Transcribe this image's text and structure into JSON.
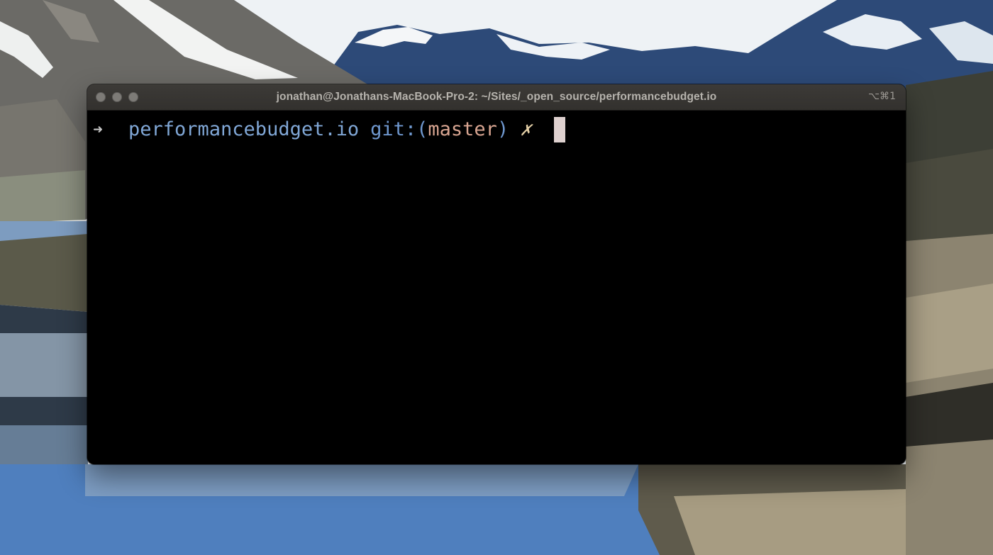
{
  "window": {
    "title": "jonathan@Jonathans-MacBook-Pro-2: ~/Sites/_open_source/performancebudget.io",
    "shortcut": "⌥⌘1"
  },
  "prompt": {
    "arrow": "➜",
    "directory": "performancebudget.io",
    "git_label": "git:(",
    "branch": "master",
    "git_close": ")",
    "dirty_marker": "✗"
  },
  "colors": {
    "directory": "#80a7d6",
    "git": "#6f98cf",
    "branch": "#d8a591",
    "cursor": "#ded1cf"
  }
}
